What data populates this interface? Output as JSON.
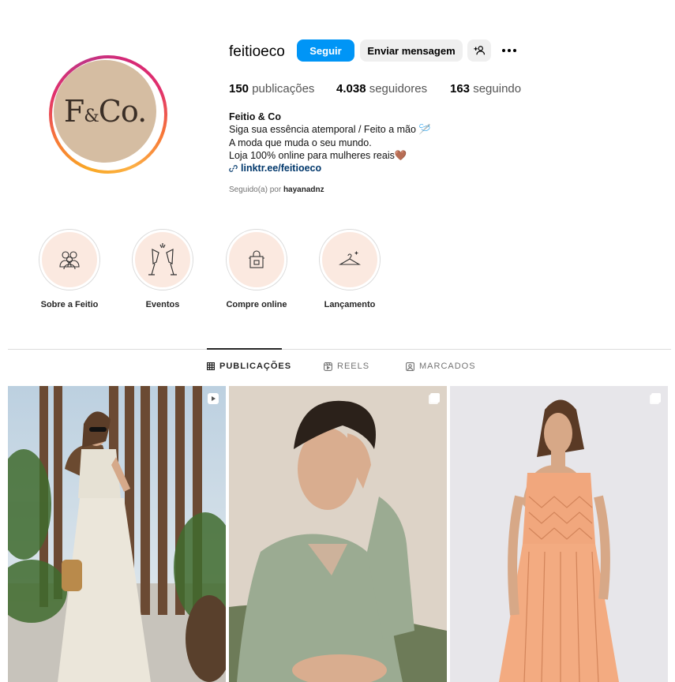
{
  "profile": {
    "avatar_text_main": "F",
    "avatar_text_amp": "&",
    "avatar_text_end": "Co.",
    "username": "feitioeco",
    "follow_label": "Seguir",
    "message_label": "Enviar mensagem",
    "more_label": "•••"
  },
  "stats": {
    "posts_count": "150",
    "posts_label": "publicações",
    "followers_count": "4.038",
    "followers_label": "seguidores",
    "following_count": "163",
    "following_label": "seguindo"
  },
  "bio": {
    "name": "Feitio & Co",
    "line1": "Siga sua essência atemporal / Feito a mão 🪡",
    "line2": "A moda que muda o seu mundo.",
    "line3": "Loja 100% online para mulheres reais🤎",
    "link": "linktr.ee/feitioeco",
    "followed_prefix": "Seguido(a) por ",
    "followed_by": "hayanadnz"
  },
  "highlights": [
    {
      "label": "Sobre a Feitio",
      "icon": "people-icon"
    },
    {
      "label": "Eventos",
      "icon": "champagne-icon"
    },
    {
      "label": "Compre online",
      "icon": "shopping-bag-icon"
    },
    {
      "label": "Lançamento",
      "icon": "hanger-icon"
    }
  ],
  "tabs": [
    {
      "label": "PUBLICAÇÕES",
      "icon": "grid-icon",
      "active": true
    },
    {
      "label": "REELS",
      "icon": "reels-icon",
      "active": false
    },
    {
      "label": "MARCADOS",
      "icon": "tagged-icon",
      "active": false
    }
  ],
  "posts": [
    {
      "badge": "reel-badge-icon",
      "desc": "woman in cropped top and wide skirt"
    },
    {
      "badge": "carousel-badge-icon",
      "desc": "woman in green shirt portrait"
    },
    {
      "badge": "carousel-badge-icon",
      "desc": "woman in peach macrame dress"
    }
  ],
  "colors": {
    "accent": "#0095f6",
    "link": "#00376b",
    "highlight_bg": "#fbe9e0",
    "avatar_bg": "#d5bda2"
  }
}
